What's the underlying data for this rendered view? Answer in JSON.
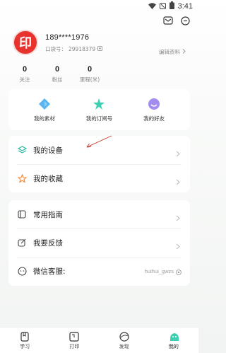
{
  "status_bar": {
    "time": "3:41",
    "icons": [
      "wifi-icon",
      "notification-off-icon",
      "battery-icon"
    ]
  },
  "top_actions": {
    "icons": [
      "mail-icon",
      "more-icon"
    ]
  },
  "profile": {
    "avatar_glyph": "印",
    "phone": "189****1976",
    "pocket_label": "口袋号：",
    "pocket_id": "29918379",
    "edit_label": "编辑资料"
  },
  "stats": [
    {
      "value": "0",
      "label": "关注"
    },
    {
      "value": "0",
      "label": "粉丝"
    },
    {
      "value": "0",
      "label": "里程(米)"
    }
  ],
  "quick_links": [
    {
      "label": "我的素材",
      "icon": "material-icon",
      "color": "#5ab4f0"
    },
    {
      "label": "我的订阅号",
      "icon": "subscription-icon",
      "color": "#3ccfb2"
    },
    {
      "label": "我的好友",
      "icon": "friends-icon",
      "color": "#a28cf0"
    }
  ],
  "menu_group_1": [
    {
      "label": "我的设备",
      "icon": "devices-icon"
    },
    {
      "label": "我的收藏",
      "icon": "favorites-icon"
    }
  ],
  "menu_group_2": [
    {
      "label": "常用指南",
      "icon": "guide-icon",
      "value": ""
    },
    {
      "label": "我要反馈",
      "icon": "feedback-icon",
      "value": ""
    },
    {
      "label": "微信客服:",
      "icon": "wechat-service-icon",
      "value": "huihui_gwzs"
    }
  ],
  "tabs": [
    {
      "label": "学习",
      "icon": "study-icon",
      "active": false
    },
    {
      "label": "打印",
      "icon": "print-icon",
      "active": false
    },
    {
      "label": "发现",
      "icon": "discover-icon",
      "active": false
    },
    {
      "label": "我的",
      "icon": "mine-icon",
      "active": true
    }
  ],
  "colors": {
    "accent": "#3ccfb2",
    "avatar": "#e8322e",
    "annotation_arrow": "#c0392b"
  }
}
